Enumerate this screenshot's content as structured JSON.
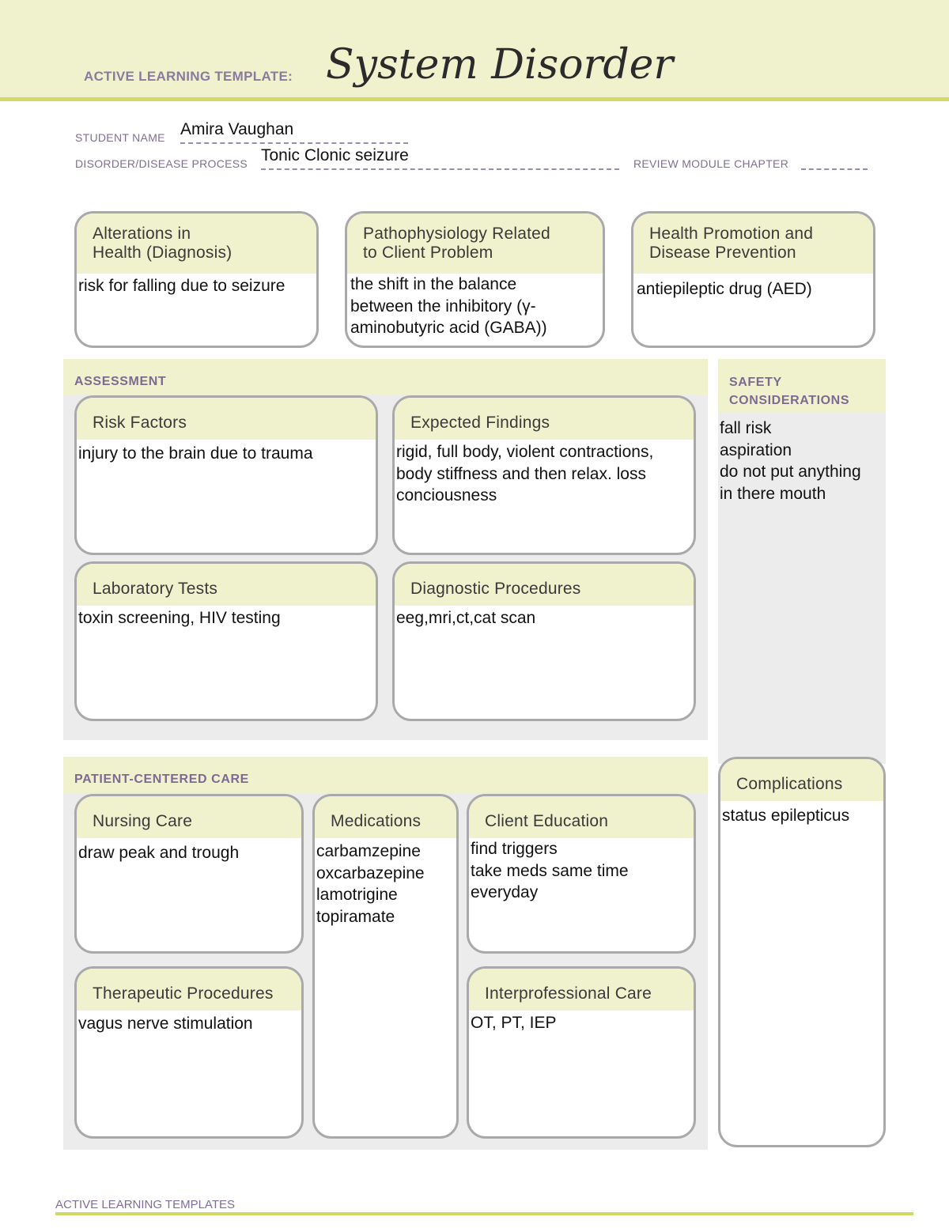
{
  "header": {
    "template_label": "ACTIVE LEARNING TEMPLATE:",
    "template_title": "System Disorder"
  },
  "fields": {
    "student_name_label": "STUDENT NAME",
    "student_name_value": "Amira Vaughan",
    "disorder_label": "DISORDER/DISEASE PROCESS",
    "disorder_value": "Tonic Clonic seizure",
    "review_module_label": "REVIEW MODULE CHAPTER",
    "review_module_value": ""
  },
  "top_boxes": {
    "alterations": {
      "title": "Alterations in\nHealth (Diagnosis)",
      "content": "risk for falling due to seizure"
    },
    "pathophysiology": {
      "title": "Pathophysiology Related\nto Client Problem",
      "content": "the shift in the balance\nbetween the inhibitory (γ-\naminobutyric acid (GABA))"
    },
    "health_promotion": {
      "title": "Health Promotion and\nDisease Prevention",
      "content": "antiepileptic drug (AED)"
    }
  },
  "assessment": {
    "title": "ASSESSMENT",
    "risk_factors": {
      "title": "Risk Factors",
      "content": "injury to the brain due to trauma"
    },
    "expected_findings": {
      "title": "Expected Findings",
      "content": "rigid, full body, violent contractions,\nbody stiffness and then relax. loss\nconciousness"
    },
    "laboratory_tests": {
      "title": "Laboratory Tests",
      "content": "toxin screening, HIV testing"
    },
    "diagnostic_procedures": {
      "title": "Diagnostic Procedures",
      "content": "eeg,mri,ct,cat scan"
    }
  },
  "safety": {
    "title": "SAFETY\nCONSIDERATIONS",
    "content": "fall risk\naspiration\ndo not put anything\nin there mouth"
  },
  "patient_care": {
    "title": "PATIENT-CENTERED CARE",
    "nursing_care": {
      "title": "Nursing Care",
      "content": "draw peak and trough"
    },
    "medications": {
      "title": "Medications",
      "content": "carbamzepine\noxcarbazepine\nlamotrigine\ntopiramate"
    },
    "client_education": {
      "title": "Client Education",
      "content": "find triggers\ntake meds same time\neveryday"
    },
    "therapeutic_procedures": {
      "title": "Therapeutic Procedures",
      "content": "vagus nerve stimulation"
    },
    "interprofessional_care": {
      "title": "Interprofessional Care",
      "content": "OT, PT, IEP"
    }
  },
  "complications": {
    "title": "Complications",
    "content": "status epilepticus"
  },
  "footer": {
    "text": "ACTIVE LEARNING TEMPLATES"
  }
}
